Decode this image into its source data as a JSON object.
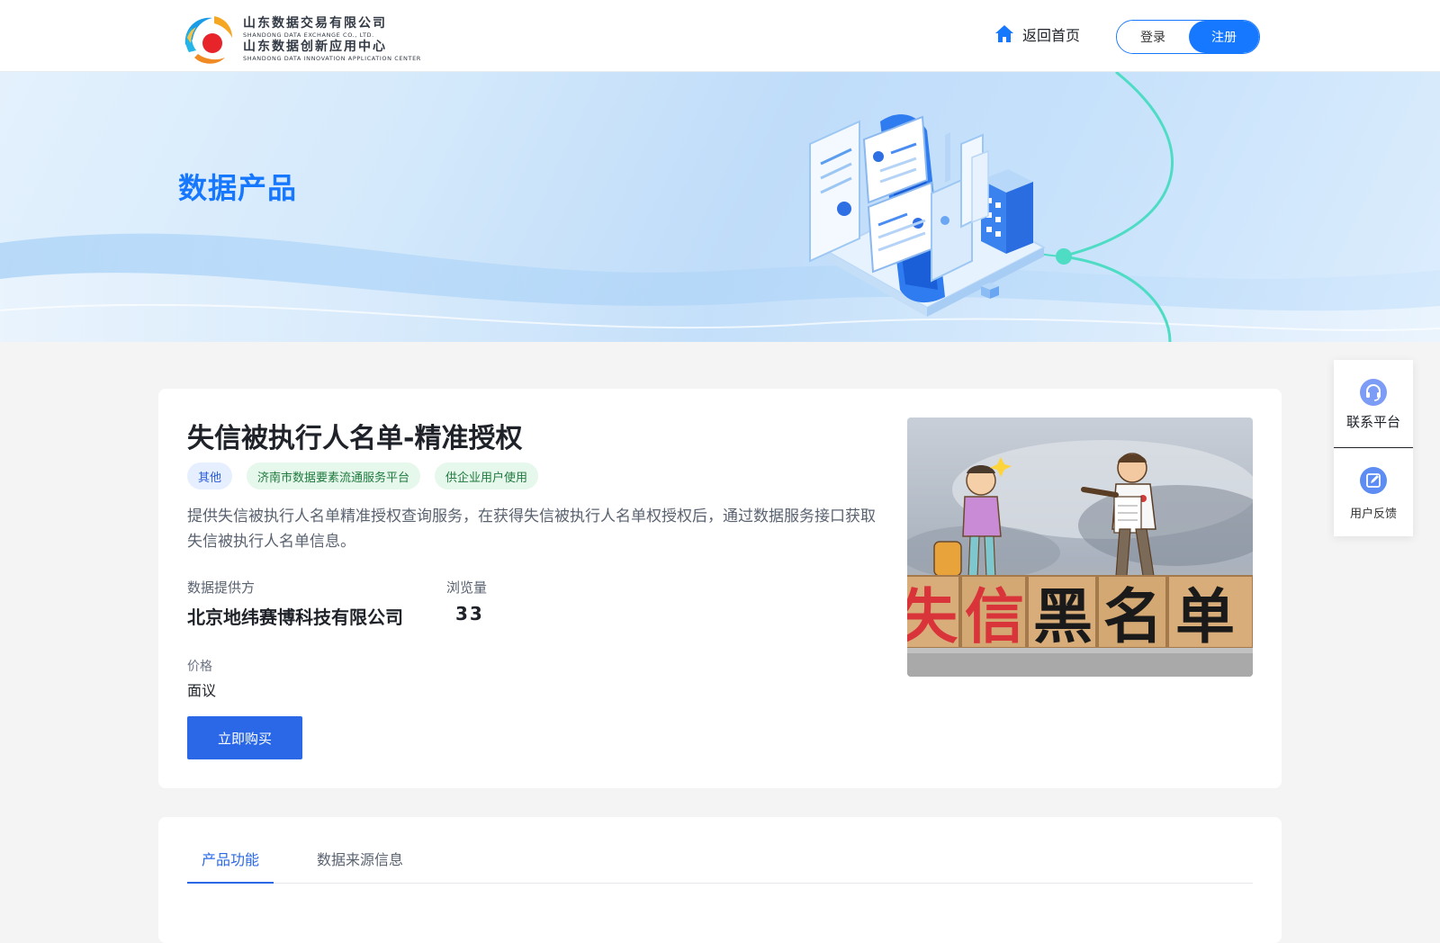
{
  "header": {
    "logo": {
      "line1_cn": "山东数据交易有限公司",
      "line1_en": "SHANDONG DATA EXCHANGE CO., LTD.",
      "line2_cn": "山东数据创新应用中心",
      "line2_en": "SHANDONG DATA INNOVATION APPLICATION CENTER"
    },
    "home_label": "返回首页",
    "login_label": "登录",
    "register_label": "注册"
  },
  "banner": {
    "title": "数据产品"
  },
  "product": {
    "title": "失信被执行人名单-精准授权",
    "tags": [
      {
        "label": "其他",
        "color": "blue"
      },
      {
        "label": "济南市数据要素流通服务平台",
        "color": "green"
      },
      {
        "label": "供企业用户使用",
        "color": "green"
      }
    ],
    "description": "提供失信被执行人名单精准授权查询服务，在获得失信被执行人名单权授权后，通过数据服务接口获取失信被执行人名单信息。",
    "provider_label": "数据提供方",
    "provider_value": "北京地纬赛博科技有限公司",
    "views_label": "浏览量",
    "views_value": "33",
    "price_label": "价格",
    "price_value": "面议",
    "buy_label": "立即购买",
    "image_caption": "失信黑名单"
  },
  "tabs": [
    {
      "label": "产品功能",
      "active": true
    },
    {
      "label": "数据来源信息",
      "active": false
    }
  ],
  "side_panel": {
    "contact_label": "联系平台",
    "feedback_label": "用户反馈"
  },
  "colors": {
    "primary": "#1677ff",
    "button": "#2b68e8",
    "tag_blue_bg": "#e6efff",
    "tag_green_bg": "#e6f7ec"
  },
  "icons": {
    "home": "home-icon",
    "contact": "headset-icon",
    "feedback": "edit-icon"
  }
}
